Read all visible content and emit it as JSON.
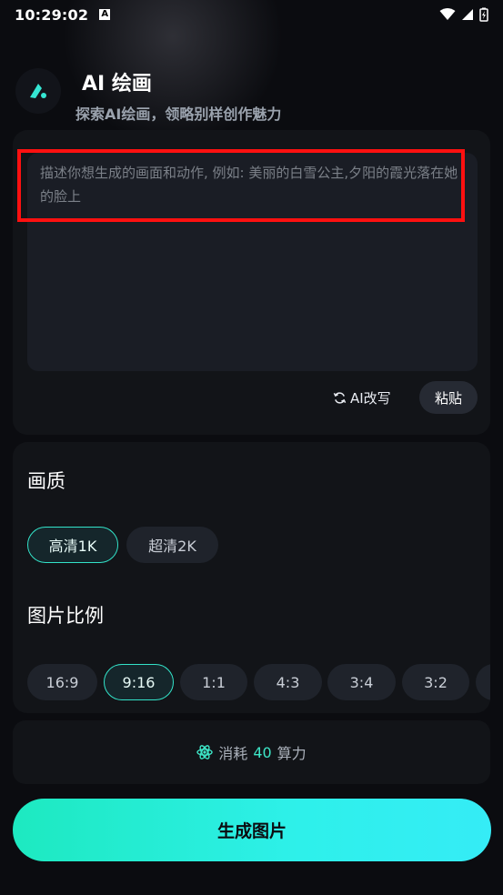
{
  "status": {
    "time": "10:29:02",
    "badge": "A"
  },
  "header": {
    "title": "AI 绘画",
    "subtitle": "探索AI绘画，领略别样创作魅力"
  },
  "prompt": {
    "placeholder": "描述你想生成的画面和动作, 例如: 美丽的白雪公主,夕阳的霞光落在她的脸上",
    "rewrite_label": "AI改写",
    "paste_label": "粘贴"
  },
  "quality": {
    "title": "画质",
    "options": [
      "高清1K",
      "超清2K"
    ],
    "selected": "高清1K"
  },
  "ratio": {
    "title": "图片比例",
    "options": [
      "16:9",
      "9:16",
      "1:1",
      "4:3",
      "3:4",
      "3:2"
    ],
    "selected": "9:16"
  },
  "cost": {
    "prefix": "消耗",
    "amount": "40",
    "suffix": "算力"
  },
  "actions": {
    "generate_label": "生成图片"
  },
  "colors": {
    "accent": "#33e3c9",
    "highlight": "#ff1010"
  }
}
